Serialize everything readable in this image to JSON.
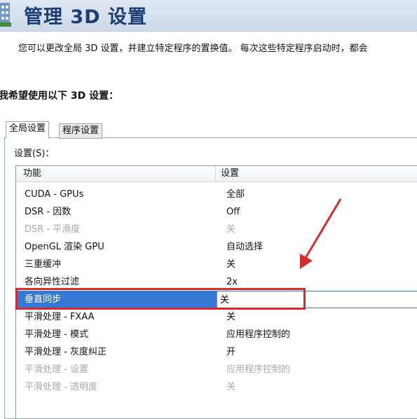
{
  "header": {
    "title": "管理 3D 设置",
    "icon": "nvidia-3d-settings-icon"
  },
  "subtitle": "您可以更改全局 3D 设置，并建立特定程序的置换值。 每次这些特定程序启动时，都会",
  "section_heading": "我希望使用以下 3D 设置：",
  "tabs": [
    {
      "label": "全局设置",
      "active": true
    },
    {
      "label": "程序设置",
      "active": false
    }
  ],
  "settings_label": "设置(S)：",
  "table": {
    "columns": [
      "功能",
      "设置"
    ],
    "rows": [
      {
        "feature": "CUDA - GPUs",
        "value": "全部"
      },
      {
        "feature": "DSR - 因数",
        "value": "Off"
      },
      {
        "feature": "DSR - 平滑度",
        "value": "关"
      },
      {
        "feature": "OpenGL 渲染 GPU",
        "value": "自动选择"
      },
      {
        "feature": "三重缓冲",
        "value": "关"
      },
      {
        "feature": "各向异性过滤",
        "value": "2x"
      },
      {
        "feature": "垂直同步",
        "value": "关"
      },
      {
        "feature": "平滑处理 - FXAA",
        "value": "关"
      },
      {
        "feature": "平滑处理 - 模式",
        "value": "应用程序控制的"
      },
      {
        "feature": "平滑处理 - 灰度纠正",
        "value": "开"
      },
      {
        "feature": "平滑处理 - 设置",
        "value": "应用程序控制的"
      },
      {
        "feature": "平滑处理 - 透明度",
        "value": "关"
      }
    ]
  },
  "colors": {
    "selection": "#3378d6",
    "annotation": "#d62b2b",
    "header_title": "#1b3f74"
  }
}
